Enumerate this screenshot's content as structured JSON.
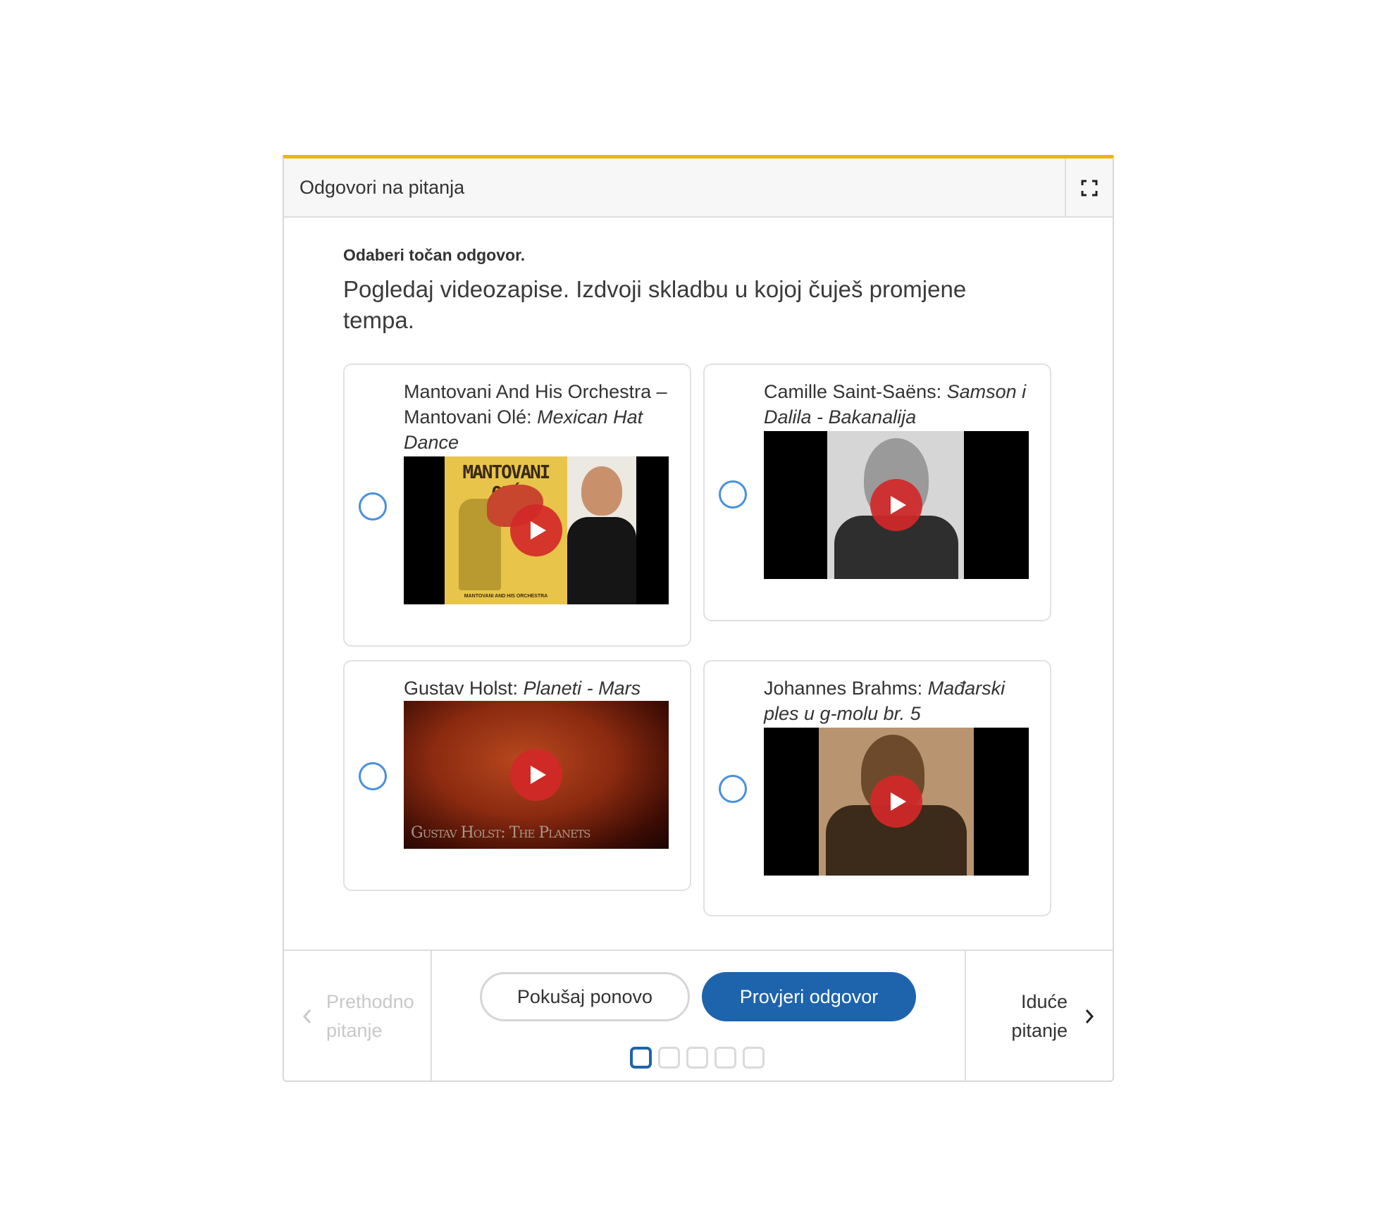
{
  "header": {
    "title": "Odgovori na pitanja"
  },
  "instruction": "Odaberi točan odgovor.",
  "question": "Pogledaj videozapise. Izdvoji skladbu u kojoj čuješ promjene tempa.",
  "options": [
    {
      "title_plain": "Mantovani And His Orchestra – Mantovani Olé: ",
      "title_italic": "Mexican Hat Dance",
      "video_text_top": "MANTOVANI OLÉ",
      "video_text_bottom": "MANTOVANI AND HIS ORCHESTRA"
    },
    {
      "title_plain": "Camille Saint-Saëns: ",
      "title_italic": "Samson i Dalila - Bakanalija"
    },
    {
      "title_plain": "Gustav Holst: ",
      "title_italic": "Planeti - Mars",
      "video_caption": "Gustav Holst: The Planets"
    },
    {
      "title_plain": "Johannes Brahms: ",
      "title_italic": "Mađarski ples u g-molu br. 5"
    }
  ],
  "footer": {
    "prev_line1": "Prethodno",
    "prev_line2": "pitanje",
    "next_line1": "Iduće",
    "next_line2": "pitanje",
    "retry_label": "Pokušaj ponovo",
    "check_label": "Provjeri odgovor",
    "pages_total": 5,
    "current_page": 1
  },
  "colors": {
    "accent": "#1e64ad",
    "top_border": "#f0b400",
    "radio": "#4a8fdb",
    "play": "#d22828"
  }
}
